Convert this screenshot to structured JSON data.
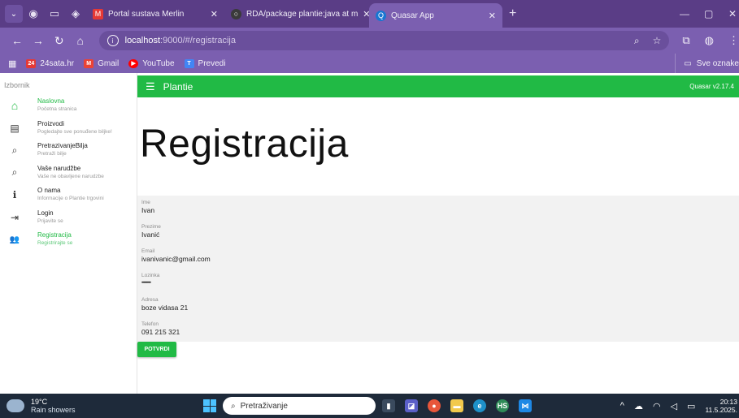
{
  "browser": {
    "tabs": [
      {
        "title": "Portal sustava Merlin",
        "color": "#e53935"
      },
      {
        "title": "RDA/package plantie;java at m",
        "color": "#3a3a3a"
      },
      {
        "title": "Quasar App",
        "color": "#1976d2"
      }
    ],
    "address": {
      "host": "localhost",
      "path": ":9000/#/registracija"
    },
    "bookmarks": [
      {
        "label": "24sata.hr",
        "color": "#e53935",
        "glyph": "24"
      },
      {
        "label": "Gmail",
        "color": "#ea4335",
        "glyph": "M"
      },
      {
        "label": "YouTube",
        "color": "#ff0000",
        "glyph": "▶"
      },
      {
        "label": "Prevedi",
        "color": "#4285f4",
        "glyph": "T"
      }
    ],
    "bookmarks_folder": "Sve oznake"
  },
  "drawer": {
    "heading": "Izbornik",
    "items": [
      {
        "title": "Naslovna",
        "subtitle": "Početna stranica",
        "icon": "home-icon",
        "glyph": "⌂"
      },
      {
        "title": "Proizvodi",
        "subtitle": "Pogledajte sve ponuđene biljke!",
        "icon": "library-books-icon",
        "glyph": "▤"
      },
      {
        "title": "PretrazivanjeBiljа",
        "subtitle": "Pretraži bilje",
        "icon": "search-icon",
        "glyph": "⌕"
      },
      {
        "title": "Vaše narudžbe",
        "subtitle": "Vaše ne obavljene narudzbe",
        "icon": "search-icon",
        "glyph": "⌕"
      },
      {
        "title": "O nama",
        "subtitle": "Informacije o Plantie trgovini",
        "icon": "info-icon",
        "glyph": "ℹ"
      },
      {
        "title": "Login",
        "subtitle": "Prijavite se",
        "icon": "login-icon",
        "glyph": "⇥"
      },
      {
        "title": "Registracija",
        "subtitle": "Registrirajte se",
        "icon": "group-add-icon",
        "glyph": "👥"
      }
    ]
  },
  "header": {
    "title": "Plantie",
    "version": "Quasar v2.17.4"
  },
  "page": {
    "title": "Registracija",
    "fields": [
      {
        "label": "Ime",
        "value": "Ivan"
      },
      {
        "label": "Prezime",
        "value": "Ivanić"
      },
      {
        "label": "Email",
        "value": "ivanivanic@gmail.com"
      },
      {
        "label": "Lozinka",
        "value": "••••••••••"
      },
      {
        "label": "Adresa",
        "value": "boze vidasa 21"
      },
      {
        "label": "Telefon",
        "value": "091 215 321"
      }
    ],
    "submit_label": "POTVRDI"
  },
  "taskbar": {
    "temperature": "19°C",
    "weather": "Rain showers",
    "search_placeholder": "Pretraživanje",
    "time": "20:13",
    "date": "11.5.2025."
  },
  "colors": {
    "accent": "#21ba45",
    "browser": "#7b5fb0"
  }
}
